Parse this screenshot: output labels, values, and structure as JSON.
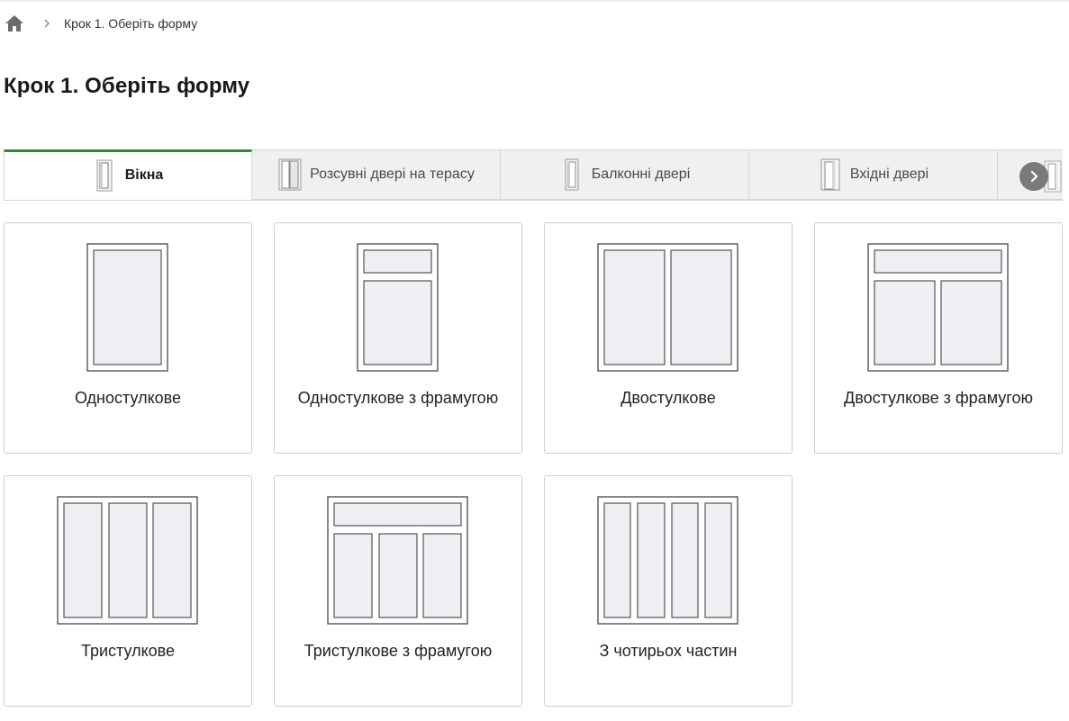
{
  "breadcrumb": {
    "home_icon": "home-icon",
    "separator_icon": "chevron-right-icon",
    "current": "Крок 1. Оберіть форму"
  },
  "page": {
    "title": "Крок 1. Оберіть форму"
  },
  "tabs": [
    {
      "label": "Вікна",
      "icon": "window-icon",
      "active": true
    },
    {
      "label": "Розсувні двері на терасу",
      "icon": "sliding-door-icon",
      "active": false
    },
    {
      "label": "Балконні двері",
      "icon": "balcony-door-icon",
      "active": false
    },
    {
      "label": "Вхідні двері",
      "icon": "entrance-door-icon",
      "active": false
    }
  ],
  "tabs_next_icon": "chevron-right-icon",
  "shapes": [
    {
      "label": "Одностулкове",
      "icon": "single-sash-window-icon"
    },
    {
      "label": "Одностулкове з фрамугою",
      "icon": "single-sash-transom-window-icon"
    },
    {
      "label": "Двостулкове",
      "icon": "double-sash-window-icon"
    },
    {
      "label": "Двостулкове з фрамугою",
      "icon": "double-sash-transom-window-icon"
    },
    {
      "label": "Тристулкове",
      "icon": "triple-sash-window-icon"
    },
    {
      "label": "Тристулкове з фрамугою",
      "icon": "triple-sash-transom-window-icon"
    },
    {
      "label": "З чотирьох частин",
      "icon": "four-part-window-icon"
    }
  ],
  "colors": {
    "accent_green": "#2e8b3a",
    "frame_stroke": "#555555",
    "glass_fill": "#eeeef3",
    "tab_bg": "#f0f0f0"
  }
}
